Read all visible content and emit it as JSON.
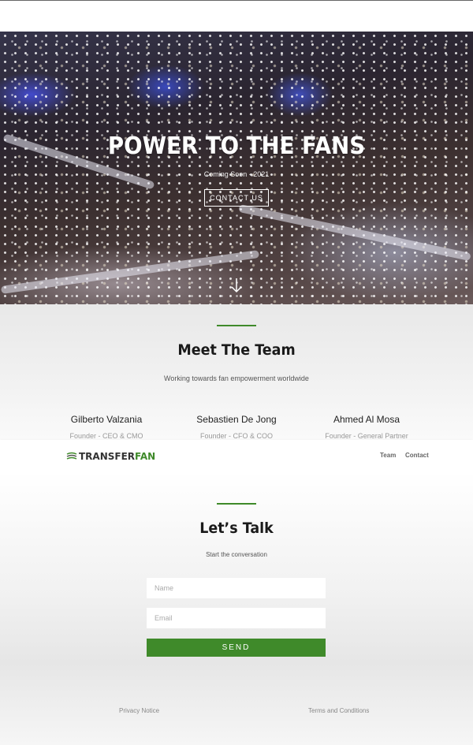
{
  "hero": {
    "title": "POWER TO THE FANS",
    "subtitle": "Coming Soon - 2021",
    "cta_label": "CONTACT US",
    "scroll_icon": "arrow-down-icon"
  },
  "team": {
    "title": "Meet The Team",
    "subtitle": "Working towards fan empowerment worldwide",
    "members": [
      {
        "name": "Gilberto Valzania",
        "role": "Founder - CEO & CMO"
      },
      {
        "name": "Sebastien De Jong",
        "role": "Founder - CFO & COO"
      },
      {
        "name": "Ahmed Al Mosa",
        "role": "Founder - General Partner"
      }
    ]
  },
  "nav": {
    "logo_part1": "TRANSFER",
    "logo_part2": "FAN",
    "links": [
      "Team",
      "Contact"
    ]
  },
  "contact": {
    "title": "Let’s Talk",
    "subtitle": "Start the conversation",
    "name_placeholder": "Name",
    "email_placeholder": "Email",
    "send_label": "SEND"
  },
  "footer": {
    "privacy": "Privacy Notice",
    "terms": "Terms and Conditions"
  },
  "colors": {
    "accent": "#3f8a2a"
  }
}
